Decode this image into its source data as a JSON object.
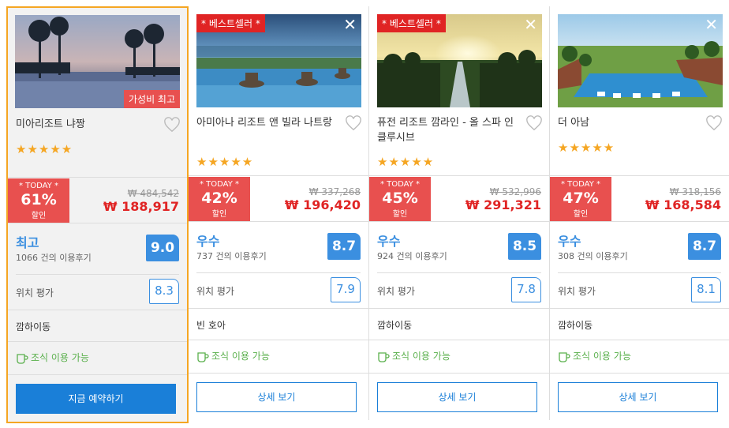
{
  "hotels": [
    {
      "name": "미아리조트 냐짱",
      "badge_top": "",
      "badge_bottom": "가성비 최고",
      "stars": "★★★★★",
      "today_label": "* TODAY *",
      "discount": "61%",
      "discount_label": "할인",
      "original_price": "₩ 484,542",
      "price": "₩ 188,917",
      "rating_word": "최고",
      "reviews": "1066 건의 이용후기",
      "score": "9.0",
      "location_label": "위치 평가",
      "location_score": "8.3",
      "area": "깜하이동",
      "breakfast": "조식 이용 가능",
      "button": "지금 예약하기"
    },
    {
      "name": "아미아나 리조트 앤 빌라 나트랑",
      "badge_top": "* 베스트셀러 *",
      "badge_bottom": "",
      "stars": "★★★★★",
      "today_label": "* TODAY *",
      "discount": "42%",
      "discount_label": "할인",
      "original_price": "₩ 337,268",
      "price": "₩ 196,420",
      "rating_word": "우수",
      "reviews": "737 건의 이용후기",
      "score": "8.7",
      "location_label": "위치 평가",
      "location_score": "7.9",
      "area": "빈 호아",
      "breakfast": "조식 이용 가능",
      "button": "상세 보기"
    },
    {
      "name": "퓨전 리조트 깜라인 - 올 스파 인클루시브",
      "badge_top": "* 베스트셀러 *",
      "badge_bottom": "",
      "stars": "★★★★★",
      "today_label": "* TODAY *",
      "discount": "45%",
      "discount_label": "할인",
      "original_price": "₩ 532,996",
      "price": "₩ 291,321",
      "rating_word": "우수",
      "reviews": "924 건의 이용후기",
      "score": "8.5",
      "location_label": "위치 평가",
      "location_score": "7.8",
      "area": "깜하이동",
      "breakfast": "조식 이용 가능",
      "button": "상세 보기"
    },
    {
      "name": "더 아남",
      "badge_top": "",
      "badge_bottom": "",
      "stars": "★★★★★",
      "today_label": "* TODAY *",
      "discount": "47%",
      "discount_label": "할인",
      "original_price": "₩ 318,156",
      "price": "₩ 168,584",
      "rating_word": "우수",
      "reviews": "308 건의 이용후기",
      "score": "8.7",
      "location_label": "위치 평가",
      "location_score": "8.1",
      "area": "깜하이동",
      "breakfast": "조식 이용 가능",
      "button": "상세 보기"
    }
  ],
  "colors": {
    "selected_border": "#f5a623",
    "discount_red": "#e8504f",
    "price_red": "#e02424",
    "score_blue": "#3b8fe0",
    "button_blue": "#1a7fd8",
    "breakfast_green": "#5ab04c",
    "star_gold": "#f5a623"
  },
  "icons": {
    "favorite": "heart-outline-icon",
    "close": "close-icon",
    "breakfast": "coffee-cup-icon"
  }
}
